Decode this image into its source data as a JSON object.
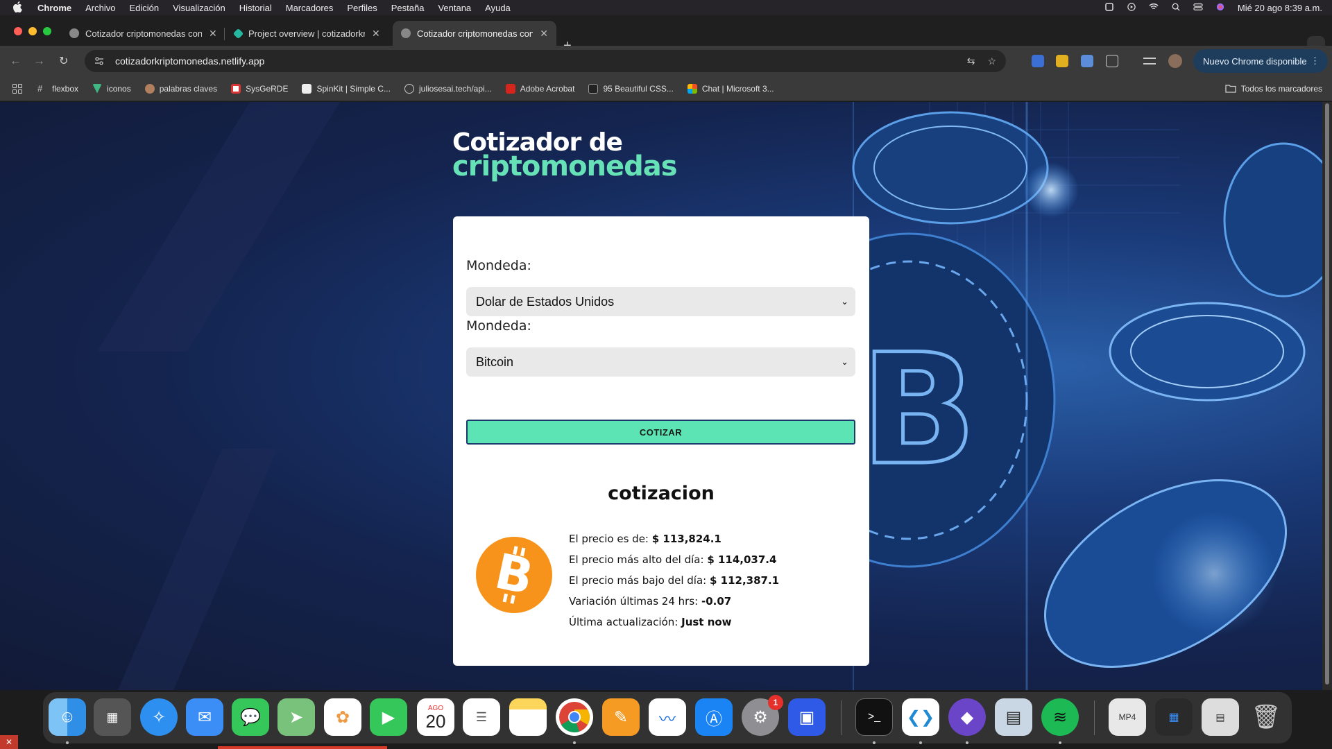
{
  "menubar": {
    "app": "Chrome",
    "items": [
      "Archivo",
      "Edición",
      "Visualización",
      "Historial",
      "Marcadores",
      "Perfiles",
      "Pestaña",
      "Ventana",
      "Ayuda"
    ],
    "clock": "Mié 20 ago 8:39 a.m."
  },
  "tabs": [
    {
      "title": "Cotizador criptomonedas con",
      "active": false
    },
    {
      "title": "Project overview | cotizadorkr",
      "active": false
    },
    {
      "title": "Cotizador criptomonedas con",
      "active": true
    }
  ],
  "toolbar": {
    "url": "cotizadorkriptomonedas.netlify.app",
    "update_label": "Nuevo Chrome disponible"
  },
  "bookmarks": {
    "items": [
      "flexbox",
      "iconos",
      "palabras claves",
      "SysGeRDE",
      "SpinKit | Simple C...",
      "juliosesai.tech/api...",
      "Adobe Acrobat",
      "95 Beautiful CSS...",
      "Chat | Microsoft 3..."
    ],
    "all_label": "Todos los marcadores"
  },
  "page": {
    "title_line1": "Cotizador de",
    "title_line2": "criptomonedas",
    "field1_label": "Mondeda:",
    "field1_value": "Dolar de Estados Unidos",
    "field2_label": "Mondeda:",
    "field2_value": "Bitcoin",
    "button_label": "COTIZAR",
    "result_title": "cotizacion",
    "results": [
      {
        "label": "El precio es de: ",
        "value": "$ 113,824.1"
      },
      {
        "label": "El precio más alto del día: ",
        "value": "$ 114,037.4"
      },
      {
        "label": "El precio más bajo del día: ",
        "value": "$ 112,387.1"
      },
      {
        "label": "Variación últimas 24 hrs: ",
        "value": "-0.07"
      },
      {
        "label": "Última actualización: ",
        "value": "Just now"
      }
    ]
  },
  "dock": {
    "calendar_month": "AGO",
    "calendar_day": "20",
    "settings_badge": "1"
  },
  "colors": {
    "accent_green": "#66e2b6",
    "button_bg": "#5ce4b4",
    "bitcoin_orange": "#f7931a",
    "page_bg": "#14244f"
  }
}
